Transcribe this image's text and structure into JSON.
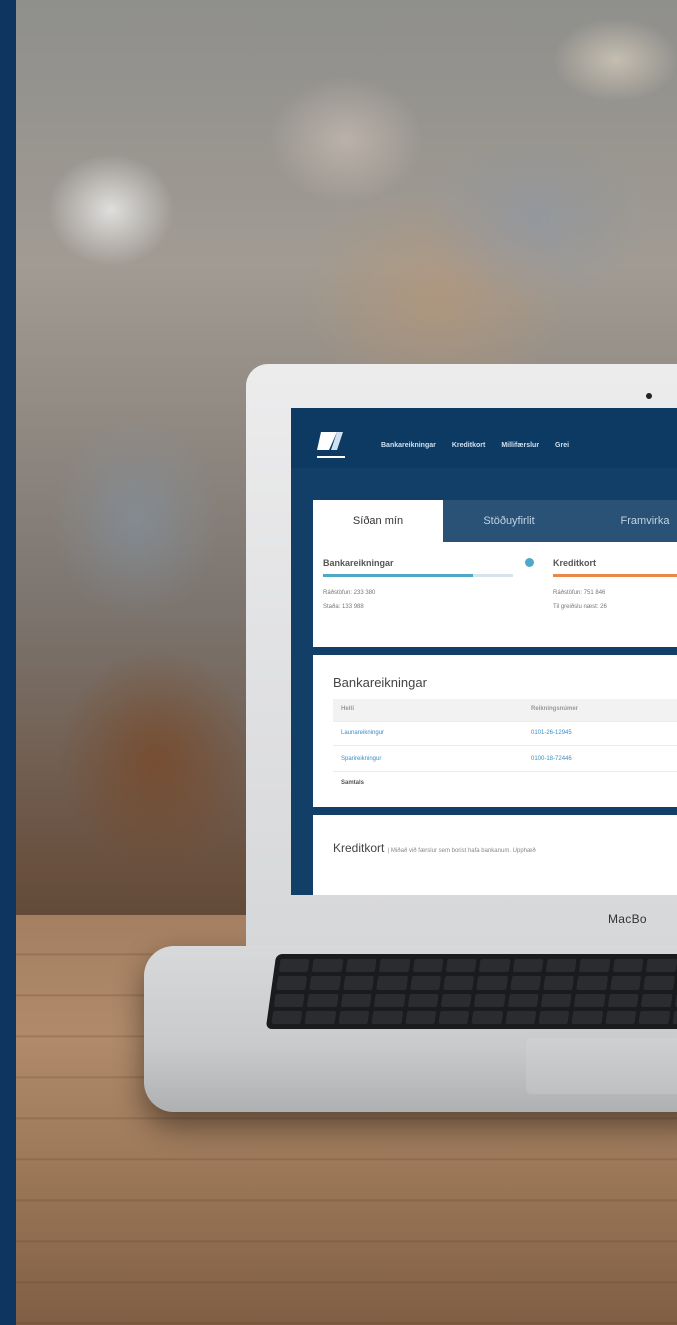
{
  "nav": {
    "items": [
      "Bankareikningar",
      "Kreditkort",
      "Millifærslur",
      "Grei"
    ]
  },
  "tabs": [
    "Síðan mín",
    "Stöðuyfirlit",
    "Framvirka"
  ],
  "summary": {
    "bank": {
      "title": "Bankareikningar",
      "line1": "Ráðstöfun: 233 380",
      "line2": "Staða: 133 988",
      "color": "#4fa8c9"
    },
    "credit": {
      "title": "Kreditkort",
      "line1": "Ráðstöfun: 751 846",
      "line2": "Til greiðslu næst: 26",
      "color": "#e8894a"
    }
  },
  "accounts": {
    "title": "Bankareikningar",
    "columns": [
      "Heiti",
      "Reikningsnúmer"
    ],
    "rows": [
      {
        "name": "Launareikningur",
        "number": "0101-26-12945"
      },
      {
        "name": "Sparireikningur",
        "number": "0100-18-72446"
      }
    ],
    "total_label": "Samtals"
  },
  "credit_section": {
    "title": "Kreditkort",
    "subtitle": "| Miðað við færslur sem borist hafa bankanum. Upphæð"
  },
  "laptop": {
    "brand": "MacBo"
  },
  "colors": {
    "frame": "#0e3560",
    "nav": "#0c3a63",
    "link": "#3d8ec5"
  },
  "icons": [
    "bank-logo-icon",
    "gear-icon"
  ]
}
